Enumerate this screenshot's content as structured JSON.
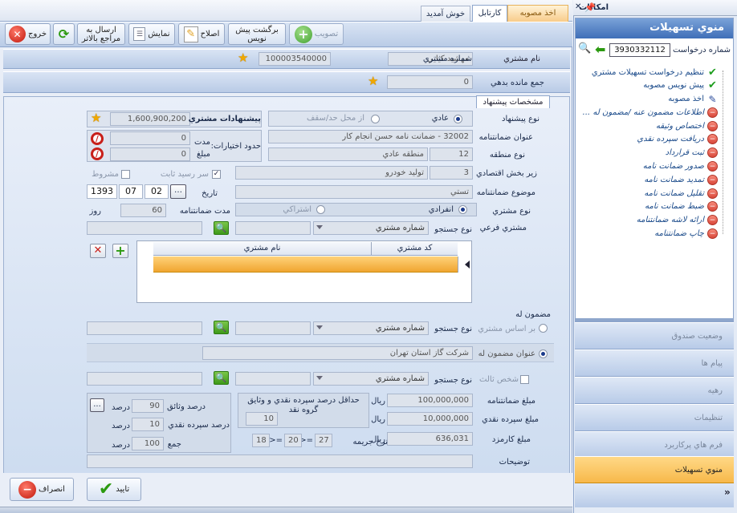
{
  "tabs": [
    {
      "label": "اخذ مصوبه",
      "active": false
    },
    {
      "label": "کارتابل",
      "active": true
    },
    {
      "label": "خوش آمدید",
      "active": false
    }
  ],
  "toolbar": {
    "approve": "تصویب",
    "return_draft": "برگشت پیش نویس",
    "edit": "اصلاح",
    "show": "نمایش",
    "send_higher": "ارسال به مراجع بالاتر",
    "exit": "خروج"
  },
  "customer": {
    "name_label": "نام مشتري",
    "name_value": "مهشيد كيايي",
    "number_label": "شماره مشتري",
    "number_value": "100003540000"
  },
  "debt": {
    "label": "جمع مانده بدهي",
    "value": "0"
  },
  "proposal_tab": "مشخصات پيشنهاد",
  "proposal": {
    "type_label": "نوع پيشنهاد",
    "type_normal": "عادي",
    "type_limit": "از محل حد/سقف",
    "offers_label": "پيشنهادات مشتري",
    "offers_value": "1,600,900,200",
    "title_label": "عنوان ضمانتنامه",
    "title_value": "32002 - ضمانت نامه حسن انجام كار",
    "authority_label": "حدود اختيارات:",
    "duration_label": "مدت",
    "duration_value": "0",
    "amount_small_label": "مبلغ",
    "amount_small_value": "0",
    "region_label": "نوع منطقه",
    "region_code": "12",
    "region_value": "منطقه عادي",
    "subsector_label": "زير بخش اقتصادي",
    "subsector_code": "3",
    "subsector_value": "توليد خودرو",
    "conditional_label": "مشروط",
    "fixed_receipt_label": "سر رسيد ثابت",
    "subject_label": "موضوع ضمانتنامه",
    "subject_value": "تستي",
    "date_label": "تاريخ",
    "date_year": "1393",
    "date_month": "07",
    "date_day": "02",
    "gt_duration_label": "مدت ضمانتنامه",
    "gt_duration_value": "60",
    "days_label": "روز"
  },
  "customer_type": {
    "label": "نوع مشتري",
    "individual": "انفرادي",
    "joint": "اشتراكي",
    "sub_customer_label": "مشتري فرعي",
    "search_type_label": "نوع جستجو",
    "search_type_value": "شماره مشتري"
  },
  "sub_table": {
    "columns": [
      "كد مشتري",
      "نام مشتري"
    ]
  },
  "beneficiary": {
    "label": "مضمون له",
    "by_customer": "بر اساس مشتري",
    "search_type_label": "نوع جستجو",
    "search_type_value": "شماره مشتري",
    "title_radio": "عنوان مضمون له",
    "title_value": "شركت گاز استان تهران",
    "third_party": "شخص ثالث",
    "third_search_label": "نوع جستجو",
    "third_search_value": "شماره مشتري"
  },
  "amounts": {
    "gt_amount_label": "مبلغ ضمانتنامه",
    "gt_amount_value": "100,000,000",
    "cash_deposit_label": "مبلغ سپرده نقدي",
    "cash_deposit_value": "10,000,000",
    "fee_label": "مبلغ كارمزد",
    "fee_value": "636,031",
    "rial": "ريال",
    "min_deposit_label": "حداقل درصد سپرده نقدي و وثايق گروه نقد",
    "min_deposit_value": "10",
    "penalty_label": "نرخ جريمه",
    "penalty_a": "27",
    "penalty_b": "20",
    "penalty_c": "18",
    "ge_sign": ">=",
    "collateral_pct_label": "درصد وثائق",
    "collateral_pct_value": "90",
    "cash_pct_label": "درصد سپرده نقدي",
    "cash_pct_value": "10",
    "sum_label": "جمع",
    "sum_value": "100",
    "percent": "درصد",
    "ellipsis": "..."
  },
  "notes_label": "توضيحات",
  "bottom": {
    "confirm": "تاييد",
    "cancel": "انصراف"
  },
  "sidebar": {
    "title_bar": "امكانات",
    "menu_title": "منوي تسهيلات",
    "request_label": "شماره درخواست",
    "request_value": "3930332112",
    "items": [
      {
        "label": "تنظيم درخواست تسهيلات مشتري",
        "state": "ok"
      },
      {
        "label": "پيش نويس مصوبه",
        "state": "ok"
      },
      {
        "label": "اخذ مصوبه",
        "state": "pen"
      },
      {
        "label": "اطلاعات مضمون عنه /مضمون له ...",
        "state": "no"
      },
      {
        "label": "اختصاص وثيقه",
        "state": "no"
      },
      {
        "label": "دريافت سپرده نقدي",
        "state": "no"
      },
      {
        "label": "ثبت قرارداد",
        "state": "no"
      },
      {
        "label": "صدور ضمانت نامه",
        "state": "no"
      },
      {
        "label": "تمديد ضمانت نامه",
        "state": "no"
      },
      {
        "label": "تقليل ضمانت نامه",
        "state": "no"
      },
      {
        "label": "ضبط ضمانت نامه",
        "state": "no"
      },
      {
        "label": "ارائه لاشه ضمانتنامه",
        "state": "no"
      },
      {
        "label": "چاپ ضمانتنامه",
        "state": "no"
      }
    ],
    "nav": [
      "وضعيت صندوق",
      "پيام ها",
      "رهيه",
      "تنظيمات",
      "فرم هاي پركاربرد",
      "منوي تسهيلات"
    ]
  }
}
